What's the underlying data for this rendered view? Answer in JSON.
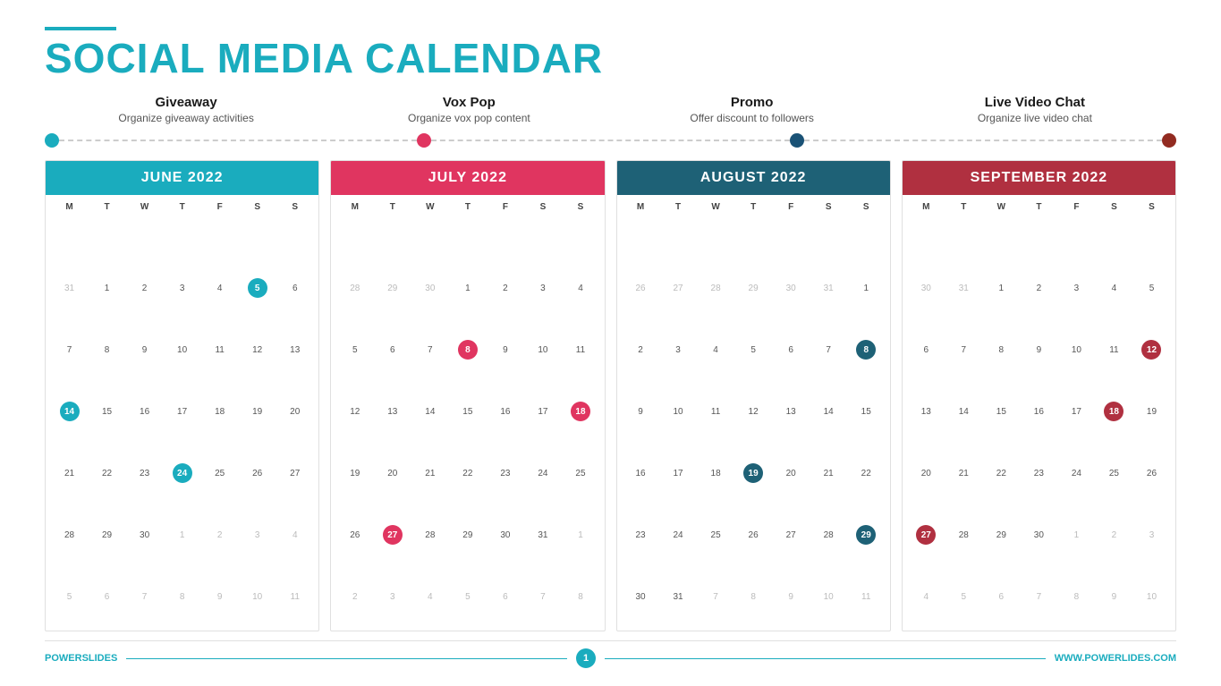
{
  "title": {
    "line1": "SOCIAL MEDIA ",
    "line1_accent": "CALENDAR"
  },
  "categories": [
    {
      "id": "giveaway",
      "title": "Giveaway",
      "desc": "Organize giveaway activities",
      "dot_color": "blue"
    },
    {
      "id": "voxpop",
      "title": "Vox Pop",
      "desc": "Organize vox pop content",
      "dot_color": "red"
    },
    {
      "id": "promo",
      "title": "Promo",
      "desc": "Offer discount to followers",
      "dot_color": "darkblue"
    },
    {
      "id": "livevideo",
      "title": "Live Video Chat",
      "desc": "Organize live video chat",
      "dot_color": "darkred"
    }
  ],
  "calendars": [
    {
      "id": "june2022",
      "month": "JUNE 2022",
      "header_class": "header-blue",
      "days": [
        "M",
        "T",
        "W",
        "T",
        "F",
        "S",
        "S"
      ],
      "highlight_class": "highlight-blue",
      "highlighted_dates": [
        5,
        14,
        24
      ],
      "rows": [
        [
          {
            "d": "31",
            "om": true
          },
          {
            "d": "1"
          },
          {
            "d": "2"
          },
          {
            "d": "3"
          },
          {
            "d": "4"
          },
          {
            "d": "5",
            "h": true
          },
          {
            "d": "6"
          }
        ],
        [
          {
            "d": "7"
          },
          {
            "d": "8"
          },
          {
            "d": "9"
          },
          {
            "d": "10"
          },
          {
            "d": "11"
          },
          {
            "d": "12"
          },
          {
            "d": "13"
          }
        ],
        [
          {
            "d": "14",
            "h": true
          },
          {
            "d": "15"
          },
          {
            "d": "16"
          },
          {
            "d": "17"
          },
          {
            "d": "18"
          },
          {
            "d": "19"
          },
          {
            "d": "20"
          }
        ],
        [
          {
            "d": "21"
          },
          {
            "d": "22"
          },
          {
            "d": "23"
          },
          {
            "d": "24",
            "h": true
          },
          {
            "d": "25"
          },
          {
            "d": "26"
          },
          {
            "d": "27"
          }
        ],
        [
          {
            "d": "28"
          },
          {
            "d": "29"
          },
          {
            "d": "30"
          },
          {
            "d": "1",
            "om": true
          },
          {
            "d": "2",
            "om": true
          },
          {
            "d": "3",
            "om": true
          },
          {
            "d": "4",
            "om": true
          }
        ],
        [
          {
            "d": "5",
            "om": true
          },
          {
            "d": "6",
            "om": true
          },
          {
            "d": "7",
            "om": true
          },
          {
            "d": "8",
            "om": true
          },
          {
            "d": "9",
            "om": true
          },
          {
            "d": "10",
            "om": true
          },
          {
            "d": "11",
            "om": true
          }
        ]
      ]
    },
    {
      "id": "july2022",
      "month": "JULY 2022",
      "header_class": "header-red",
      "days": [
        "M",
        "T",
        "W",
        "T",
        "F",
        "S",
        "S"
      ],
      "highlight_class": "highlight-red",
      "highlighted_dates": [
        8,
        18,
        27
      ],
      "rows": [
        [
          {
            "d": "28",
            "om": true
          },
          {
            "d": "29",
            "om": true
          },
          {
            "d": "30",
            "om": true
          },
          {
            "d": "1"
          },
          {
            "d": "2"
          },
          {
            "d": "3"
          },
          {
            "d": "4"
          }
        ],
        [
          {
            "d": "5"
          },
          {
            "d": "6"
          },
          {
            "d": "7"
          },
          {
            "d": "8",
            "h": true
          },
          {
            "d": "9"
          },
          {
            "d": "10"
          },
          {
            "d": "11"
          }
        ],
        [
          {
            "d": "12"
          },
          {
            "d": "13"
          },
          {
            "d": "14"
          },
          {
            "d": "15"
          },
          {
            "d": "16"
          },
          {
            "d": "17"
          },
          {
            "d": "18",
            "h": true
          }
        ],
        [
          {
            "d": "19"
          },
          {
            "d": "20"
          },
          {
            "d": "21"
          },
          {
            "d": "22"
          },
          {
            "d": "23"
          },
          {
            "d": "24"
          },
          {
            "d": "25"
          }
        ],
        [
          {
            "d": "26"
          },
          {
            "d": "27",
            "h": true
          },
          {
            "d": "28"
          },
          {
            "d": "29"
          },
          {
            "d": "30"
          },
          {
            "d": "31"
          },
          {
            "d": "1",
            "om": true
          }
        ],
        [
          {
            "d": "2",
            "om": true
          },
          {
            "d": "3",
            "om": true
          },
          {
            "d": "4",
            "om": true
          },
          {
            "d": "5",
            "om": true
          },
          {
            "d": "6",
            "om": true
          },
          {
            "d": "7",
            "om": true
          },
          {
            "d": "8",
            "om": true
          }
        ]
      ]
    },
    {
      "id": "august2022",
      "month": "AUGUST 2022",
      "header_class": "header-darkblue",
      "days": [
        "M",
        "T",
        "W",
        "T",
        "F",
        "S",
        "S"
      ],
      "highlight_class": "highlight-darkblue",
      "highlighted_dates": [
        8,
        19,
        29
      ],
      "rows": [
        [
          {
            "d": "26",
            "om": true
          },
          {
            "d": "27",
            "om": true
          },
          {
            "d": "28",
            "om": true
          },
          {
            "d": "29",
            "om": true
          },
          {
            "d": "30",
            "om": true
          },
          {
            "d": "31",
            "om": true
          },
          {
            "d": "1"
          }
        ],
        [
          {
            "d": "2"
          },
          {
            "d": "3"
          },
          {
            "d": "4"
          },
          {
            "d": "5"
          },
          {
            "d": "6"
          },
          {
            "d": "7"
          },
          {
            "d": "8",
            "h": true
          }
        ],
        [
          {
            "d": "9"
          },
          {
            "d": "10"
          },
          {
            "d": "11"
          },
          {
            "d": "12"
          },
          {
            "d": "13"
          },
          {
            "d": "14"
          },
          {
            "d": "15"
          }
        ],
        [
          {
            "d": "16"
          },
          {
            "d": "17"
          },
          {
            "d": "18"
          },
          {
            "d": "19",
            "h": true
          },
          {
            "d": "20"
          },
          {
            "d": "21"
          },
          {
            "d": "22"
          }
        ],
        [
          {
            "d": "23"
          },
          {
            "d": "24"
          },
          {
            "d": "25"
          },
          {
            "d": "26"
          },
          {
            "d": "27"
          },
          {
            "d": "28"
          },
          {
            "d": "29",
            "h": true
          }
        ],
        [
          {
            "d": "30"
          },
          {
            "d": "31"
          },
          {
            "d": "7",
            "om": true
          },
          {
            "d": "8",
            "om": true
          },
          {
            "d": "9",
            "om": true
          },
          {
            "d": "10",
            "om": true
          },
          {
            "d": "11",
            "om": true
          }
        ]
      ]
    },
    {
      "id": "september2022",
      "month": "SEPTEMBER 2022",
      "header_class": "header-darkred",
      "days": [
        "M",
        "T",
        "W",
        "T",
        "F",
        "S",
        "S"
      ],
      "highlight_class": "highlight-darkred",
      "highlighted_dates": [
        12,
        18,
        27
      ],
      "rows": [
        [
          {
            "d": "30",
            "om": true
          },
          {
            "d": "31",
            "om": true
          },
          {
            "d": "1"
          },
          {
            "d": "2"
          },
          {
            "d": "3"
          },
          {
            "d": "4"
          },
          {
            "d": "5"
          }
        ],
        [
          {
            "d": "6"
          },
          {
            "d": "7"
          },
          {
            "d": "8"
          },
          {
            "d": "9"
          },
          {
            "d": "10"
          },
          {
            "d": "11"
          },
          {
            "d": "12",
            "h": true
          }
        ],
        [
          {
            "d": "13"
          },
          {
            "d": "14"
          },
          {
            "d": "15"
          },
          {
            "d": "16"
          },
          {
            "d": "17"
          },
          {
            "d": "18",
            "h": true
          },
          {
            "d": "19"
          }
        ],
        [
          {
            "d": "20"
          },
          {
            "d": "21"
          },
          {
            "d": "22"
          },
          {
            "d": "23"
          },
          {
            "d": "24"
          },
          {
            "d": "25"
          },
          {
            "d": "26"
          }
        ],
        [
          {
            "d": "27",
            "h": true
          },
          {
            "d": "28"
          },
          {
            "d": "29"
          },
          {
            "d": "30"
          },
          {
            "d": "1",
            "om": true
          },
          {
            "d": "2",
            "om": true
          },
          {
            "d": "3",
            "om": true
          }
        ],
        [
          {
            "d": "4",
            "om": true
          },
          {
            "d": "5",
            "om": true
          },
          {
            "d": "6",
            "om": true
          },
          {
            "d": "7",
            "om": true
          },
          {
            "d": "8",
            "om": true
          },
          {
            "d": "9",
            "om": true
          },
          {
            "d": "10",
            "om": true
          }
        ]
      ]
    }
  ],
  "footer": {
    "brand_left": "POWER",
    "brand_left_accent": "SLIDES",
    "page_number": "1",
    "brand_right": "WWW.POWERLIDES.COM"
  }
}
